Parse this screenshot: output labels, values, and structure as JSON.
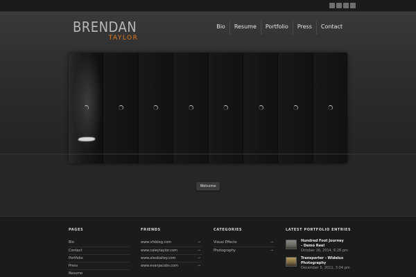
{
  "brand": {
    "name": "BRENDAN",
    "sub": "TAYLOR",
    "accent": "#e07a20"
  },
  "social_icons": [
    "youtube-icon",
    "vimeo-icon",
    "rss-icon",
    "email-icon"
  ],
  "nav": [
    "Bio",
    "Resume",
    "Portfolio",
    "Press",
    "Contact"
  ],
  "slider": {
    "slide_count": 8
  },
  "welcome": "Welcome",
  "footer": {
    "pages": {
      "title": "PAGES",
      "items": [
        "Bio",
        "Contact",
        "Portfolio",
        "Press",
        "Resume"
      ]
    },
    "friends": {
      "title": "FRIENDS",
      "items": [
        "www.vfxblog.com",
        "www.caleytaylor.com",
        "www.alexbailey.com",
        "www.evanjacobs.com"
      ],
      "arrow": "→"
    },
    "categories": {
      "title": "CATEGORIES",
      "items": [
        "Visual Effects",
        "Photography"
      ],
      "arrow": "→"
    },
    "latest": {
      "title": "LATEST PORTFOLIO ENTRIES",
      "entries": [
        {
          "title": "Hundred Foot Journey - Demo Reel",
          "date": "October 16, 2014, 6:26 pm"
        },
        {
          "title": "Transporter - Widelux Photography",
          "date": "December 5, 2011, 3:04 pm"
        }
      ]
    }
  }
}
